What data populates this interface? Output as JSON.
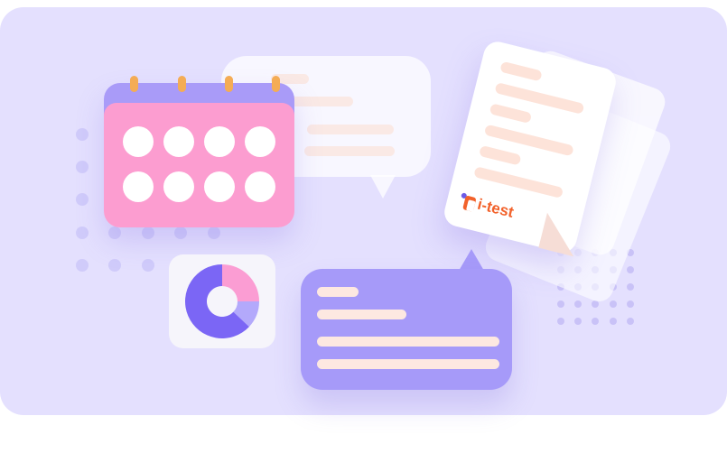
{
  "brand": {
    "text": "i-test"
  },
  "colors": {
    "background": "#e4e0fe",
    "calendar_header": "#a99bf8",
    "calendar_body": "#fc9dd0",
    "calendar_rings": "#f4ac55",
    "bubble_purple": "#a69af9",
    "text_lines": "#fde8e1",
    "brand_orange": "#f2622b",
    "brand_purple": "#6c5ce7"
  },
  "icons": [
    "calendar-icon",
    "speech-bubble-icon",
    "document-stack-icon",
    "donut-chart-icon",
    "chat-bubble-icon",
    "dot-grid-decoration"
  ],
  "chart_data": {
    "type": "pie",
    "categories": [
      "pink",
      "light-purple",
      "purple"
    ],
    "values": [
      25,
      12,
      63
    ],
    "colors": [
      "#fb9dd3",
      "#b3a9fb",
      "#7b66f5"
    ]
  }
}
